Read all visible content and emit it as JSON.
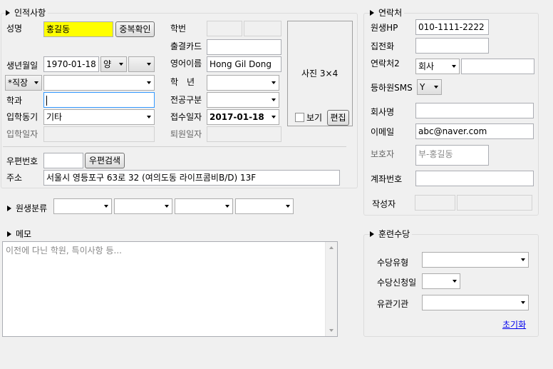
{
  "personal": {
    "title": "인적사항",
    "name_label": "성명",
    "name_value": "홍길동",
    "dup_check_button": "중복확인",
    "student_no_label": "학번",
    "attendance_card_label": "출결카드",
    "birth_label": "생년월일",
    "birth_value": "1970-01-18",
    "calendar_value": "양",
    "english_name_label": "영어이름",
    "english_name_value": "Hong Gil Dong",
    "job_value": "*직장",
    "grade_label": "학　년",
    "dept_label": "학과",
    "major_type_label": "전공구분",
    "entry_motive_label": "입학동기",
    "entry_motive_value": "기타",
    "receipt_date_label": "접수일자",
    "receipt_date_value": "2017-01-18",
    "entry_date_label": "입학일자",
    "leave_date_label": "퇴원일자",
    "photo_label": "사진 3×4",
    "view_label": "보기",
    "edit_button": "편집",
    "zip_label": "우편번호",
    "zip_search_button": "우편검색",
    "address_label": "주소",
    "address_value": "서울시 영등포구 63로 32 (여의도동 라이프콤비B/D) 13F"
  },
  "category": {
    "title": "원생분류"
  },
  "memo": {
    "title": "메모",
    "placeholder": "이전에 다닌 학원, 특이사항 등..."
  },
  "contact": {
    "title": "연락처",
    "hp_label": "원생HP",
    "hp_value": "010-1111-2222",
    "home_phone_label": "집전화",
    "contact2_label": "연락처2",
    "contact2_type": "회사",
    "sms_label": "등하원SMS",
    "sms_value": "Y",
    "company_label": "회사명",
    "email_label": "이메일",
    "email_value": "abc@naver.com",
    "guardian_label": "보호자",
    "guardian_value": "부-홍길동",
    "account_label": "계좌번호",
    "writer_label": "작성자"
  },
  "allowance": {
    "title": "훈련수당",
    "type_label": "수당유형",
    "apply_date_label": "수당신청일",
    "agency_label": "유관기관",
    "reset_link": "초기화"
  }
}
